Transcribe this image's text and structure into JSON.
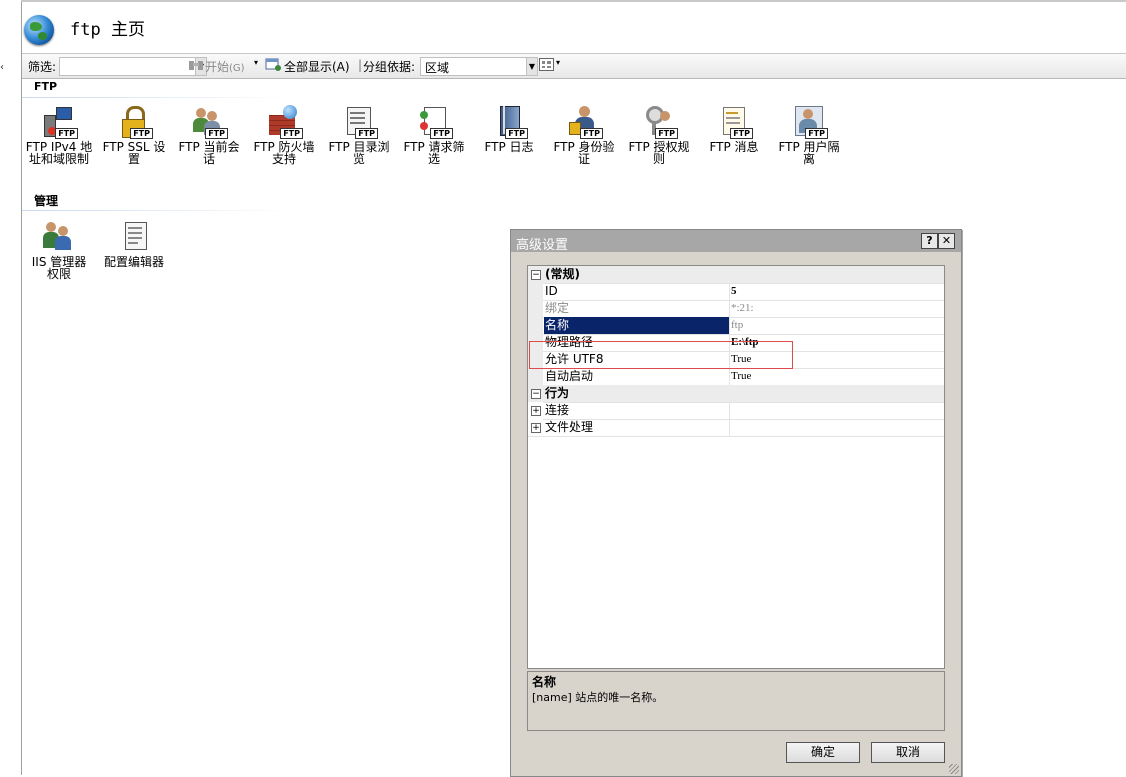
{
  "header": {
    "title": "ftp 主页"
  },
  "toolbar": {
    "filter_label": "筛选:",
    "start_label": "开始",
    "start_shortcut": "(G)",
    "show_all_label": "全部显示(A)",
    "group_by_label": "分组依据:",
    "group_by_value": "区域"
  },
  "sections": {
    "ftp": "FTP",
    "manage": "管理"
  },
  "ftp_features": [
    {
      "line1": "FTP IPv4 地",
      "line2": "址和域限制",
      "icon": "ipv4-restriction-icon"
    },
    {
      "line1": "FTP SSL 设",
      "line2": "置",
      "icon": "ssl-lock-icon"
    },
    {
      "line1": "FTP 当前会",
      "line2": "话",
      "icon": "sessions-icon"
    },
    {
      "line1": "FTP 防火墙",
      "line2": "支持",
      "icon": "firewall-icon"
    },
    {
      "line1": "FTP 目录浏",
      "line2": "览",
      "icon": "directory-browse-icon"
    },
    {
      "line1": "FTP 请求筛",
      "line2": "选",
      "icon": "request-filter-icon"
    },
    {
      "line1": "FTP 日志",
      "line2": "",
      "icon": "log-book-icon"
    },
    {
      "line1": "FTP 身份验",
      "line2": "证",
      "icon": "authentication-icon"
    },
    {
      "line1": "FTP 授权规",
      "line2": "则",
      "icon": "authorization-key-icon"
    },
    {
      "line1": "FTP 消息",
      "line2": "",
      "icon": "message-icon"
    },
    {
      "line1": "FTP 用户隔",
      "line2": "离",
      "icon": "user-isolation-icon"
    }
  ],
  "ftp_tag": "FTP",
  "manage_features": [
    {
      "line1": "IIS 管理器",
      "line2": "权限",
      "icon": "iis-manager-users-icon"
    },
    {
      "line1": "配置编辑器",
      "line2": "",
      "icon": "config-editor-icon"
    }
  ],
  "dialog": {
    "title": "高级设置",
    "help_btn": "?",
    "close_btn": "✕",
    "categories": {
      "general": "(常规)",
      "behavior": "行为"
    },
    "properties": {
      "id": {
        "name": "ID",
        "value": "5"
      },
      "binding": {
        "name": "绑定",
        "value": "*:21:"
      },
      "name": {
        "name": "名称",
        "value": "ftp"
      },
      "physical_path": {
        "name": "物理路径",
        "value": "E:\\ftp"
      },
      "allow_utf8": {
        "name": "允许 UTF8",
        "value": "True"
      },
      "auto_start": {
        "name": "自动启动",
        "value": "True"
      },
      "connections": {
        "name": "连接",
        "value": ""
      },
      "file_handling": {
        "name": "文件处理",
        "value": ""
      }
    },
    "description": {
      "title": "名称",
      "text": "[name] 站点的唯一名称。"
    },
    "ok_label": "确定",
    "cancel_label": "取消",
    "colors": {
      "selection": "#0a246a",
      "highlight_box": "#e04a4a"
    }
  }
}
